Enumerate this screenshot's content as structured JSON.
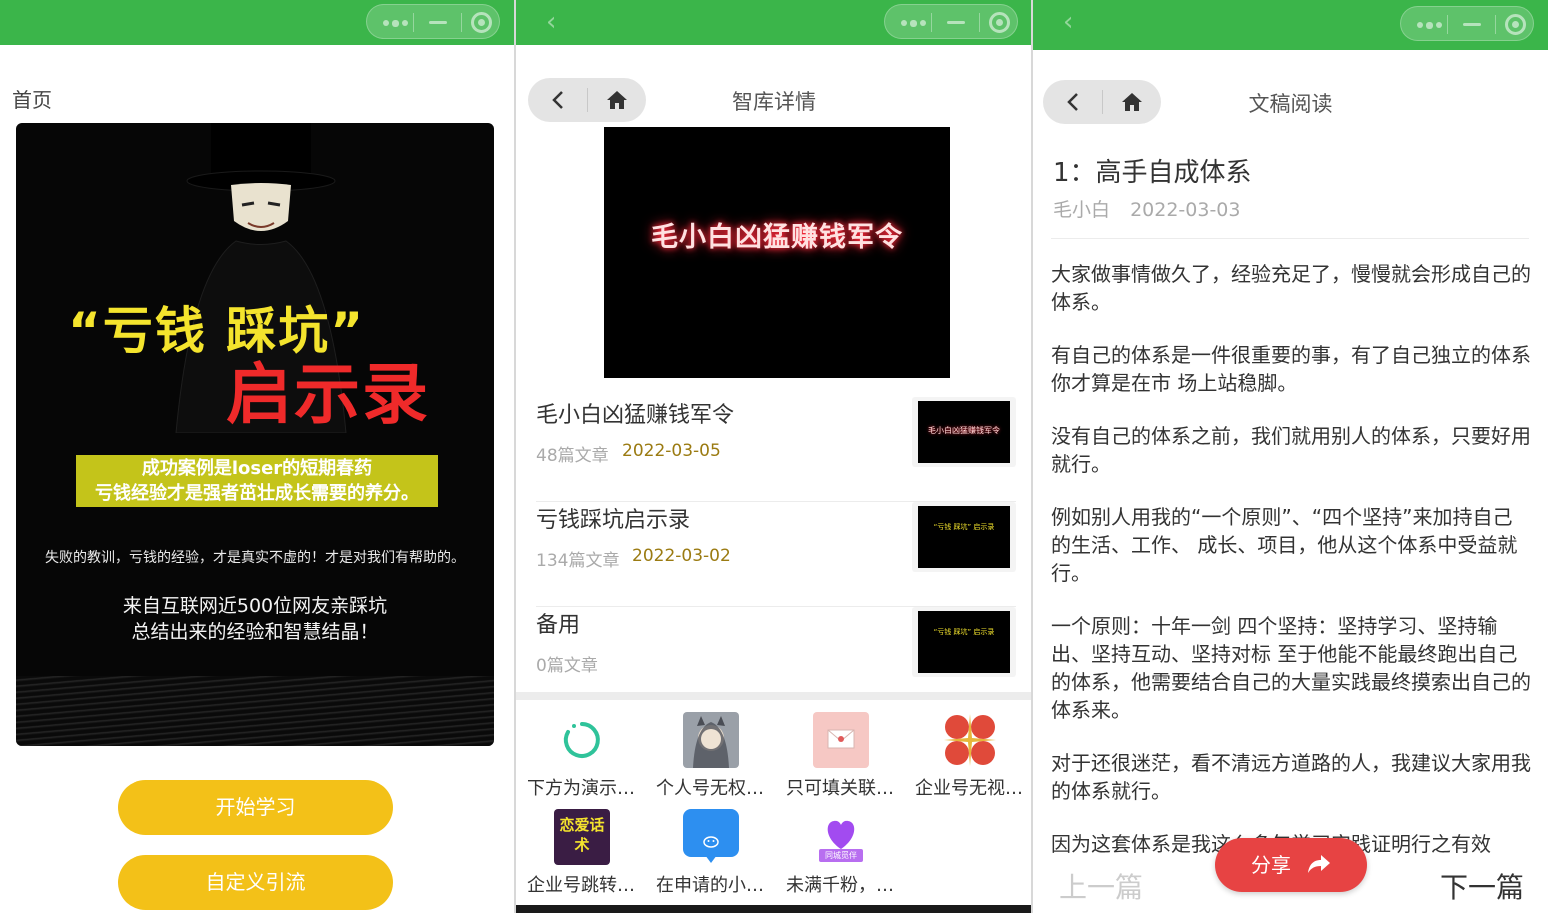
{
  "colors": {
    "topbar": "#3bb54a",
    "accent_yellow": "#f3c118",
    "share_red": "#e74343",
    "date_gold": "#9b7b12"
  },
  "panel1": {
    "title": "首页",
    "poster": {
      "headline_quote": "“亏钱 踩坑”",
      "headline_big": "启示录",
      "band_line1": "成功案例是loser的短期春药",
      "band_line2": "亏钱经验才是强者茁壮成长需要的养分。",
      "small_line": "失败的教训，亏钱的经验，才是真实不虚的！才是对我们有帮助的。",
      "mid_line1": "来自互联网近500位网友亲踩坑",
      "mid_line2": "总结出来的经验和智慧结晶！"
    },
    "btn_start": "开始学习",
    "btn_custom": "自定义引流"
  },
  "panel2": {
    "nav_title": "智库详情",
    "banner_text": "毛小白凶猛赚钱军令",
    "items": [
      {
        "name": "毛小白凶猛赚钱军令",
        "count": "48篇文章",
        "date": "2022-03-05",
        "thumb": "毛小白凶猛赚钱军令"
      },
      {
        "name": "亏钱踩坑启示录",
        "count": "134篇文章",
        "date": "2022-03-02",
        "thumb": "“亏钱 踩坑” 启示录"
      },
      {
        "name": "备用",
        "count": "0篇文章",
        "date": "",
        "thumb": "“亏钱 踩坑” 启示录"
      }
    ],
    "apps": [
      {
        "label": "下方为演示…",
        "icon": "loading-icon"
      },
      {
        "label": "个人号无权…",
        "icon": "girl-avatar-icon"
      },
      {
        "label": "只可填关联…",
        "icon": "envelope-icon"
      },
      {
        "label": "企业号无视…",
        "icon": "traffic-gold-icon"
      },
      {
        "label": "企业号跳转…",
        "icon": "love-talk-icon",
        "icon_text": "恋爱话术"
      },
      {
        "label": "在申请的小…",
        "icon": "chat-bubble-icon"
      },
      {
        "label": "未满千粉，…",
        "icon": "heart-icon",
        "icon_text": "同城觅伴"
      }
    ]
  },
  "panel3": {
    "nav_title": "文稿阅读",
    "article_title": "1：高手自成体系",
    "author": "毛小白",
    "date": "2022-03-03",
    "paragraphs": [
      "大家做事情做久了，经验充足了，慢慢就会形成自己的体系。",
      "有自己的体系是一件很重要的事，有了自己独立的体系你才算是在市 场上站稳脚。",
      "没有自己的体系之前，我们就用别人的体系，只要好用就行。",
      "例如别人用我的“一个原则”、“四个坚持”来加持自己的生活、工作、 成长、项目，他从这个体系中受益就行。",
      "一个原则：十年一剑 四个坚持：坚持学习、坚持输出、坚持互动、坚持对标 至于他能不能最终跑出自己的体系，他需要结合自己的大量实践最终摸索出自己的体系来。",
      "对于还很迷茫，看不清远方道路的人，我建议大家用我的体系就行。",
      "因为这套体系是我这么多年学习实践证明行之有效"
    ],
    "prev_label": "上一篇",
    "next_label": "下一篇",
    "share_label": "分享"
  }
}
